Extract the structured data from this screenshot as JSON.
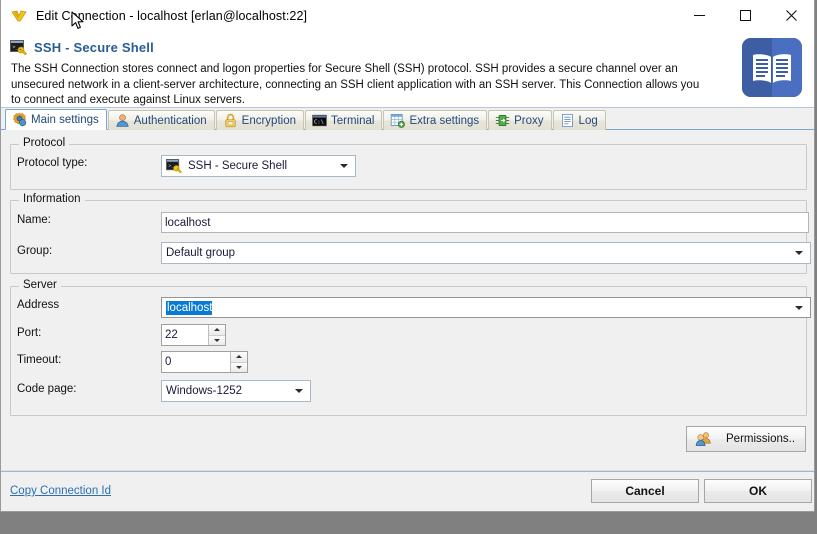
{
  "window": {
    "title": "Edit Connection - localhost [erlan@localhost:22]",
    "app_icon": "connection-icon",
    "minimize_label": "—",
    "maximize_label": "□",
    "close_label": "✕"
  },
  "header": {
    "icon": "ssh-terminal-key-icon",
    "title": "SSH - Secure Shell",
    "description": "The SSH Connection stores connect and logon properties for Secure Shell (SSH) protocol. SSH provides a secure channel over an unsecured network in a client-server architecture, connecting an SSH client application with an SSH server. This Connection allows you to connect and execute against Linux servers.",
    "logo_icon": "book-icon",
    "logo_color": "#3a5ca0",
    "title_color": "#2b5d93"
  },
  "tabs": [
    {
      "label": "Main settings",
      "icon": "gear-icon",
      "active": true
    },
    {
      "label": "Authentication",
      "icon": "user-icon",
      "active": false
    },
    {
      "label": "Encryption",
      "icon": "padlock-icon",
      "active": false
    },
    {
      "label": "Terminal",
      "icon": "console-icon",
      "active": false
    },
    {
      "label": "Extra settings",
      "icon": "grid-plus-icon",
      "active": false
    },
    {
      "label": "Proxy",
      "icon": "proxy-icon",
      "active": false
    },
    {
      "label": "Log",
      "icon": "log-document-icon",
      "active": false
    }
  ],
  "protocol_group": {
    "legend": "Protocol",
    "type_label": "Protocol type:",
    "type_value": "SSH - Secure Shell",
    "type_icon": "ssh-terminal-key-icon"
  },
  "information_group": {
    "legend": "Information",
    "name_label": "Name:",
    "name_value": "localhost",
    "group_label": "Group:",
    "group_value": "Default group"
  },
  "server_group": {
    "legend": "Server",
    "address_label": "Address",
    "address_value": "localhost",
    "address_selected": true,
    "selection_color": "#0a7bd4",
    "port_label": "Port:",
    "port_value": "22",
    "timeout_label": "Timeout:",
    "timeout_value": "0",
    "codepage_label": "Code page:",
    "codepage_value": "Windows-1252"
  },
  "permissions_button": {
    "label": "Permissions..",
    "icon": "users-icon"
  },
  "footer": {
    "link_label": "Copy Connection Id",
    "link_color": "#2a6fb5",
    "cancel_label": "Cancel",
    "ok_label": "OK"
  }
}
